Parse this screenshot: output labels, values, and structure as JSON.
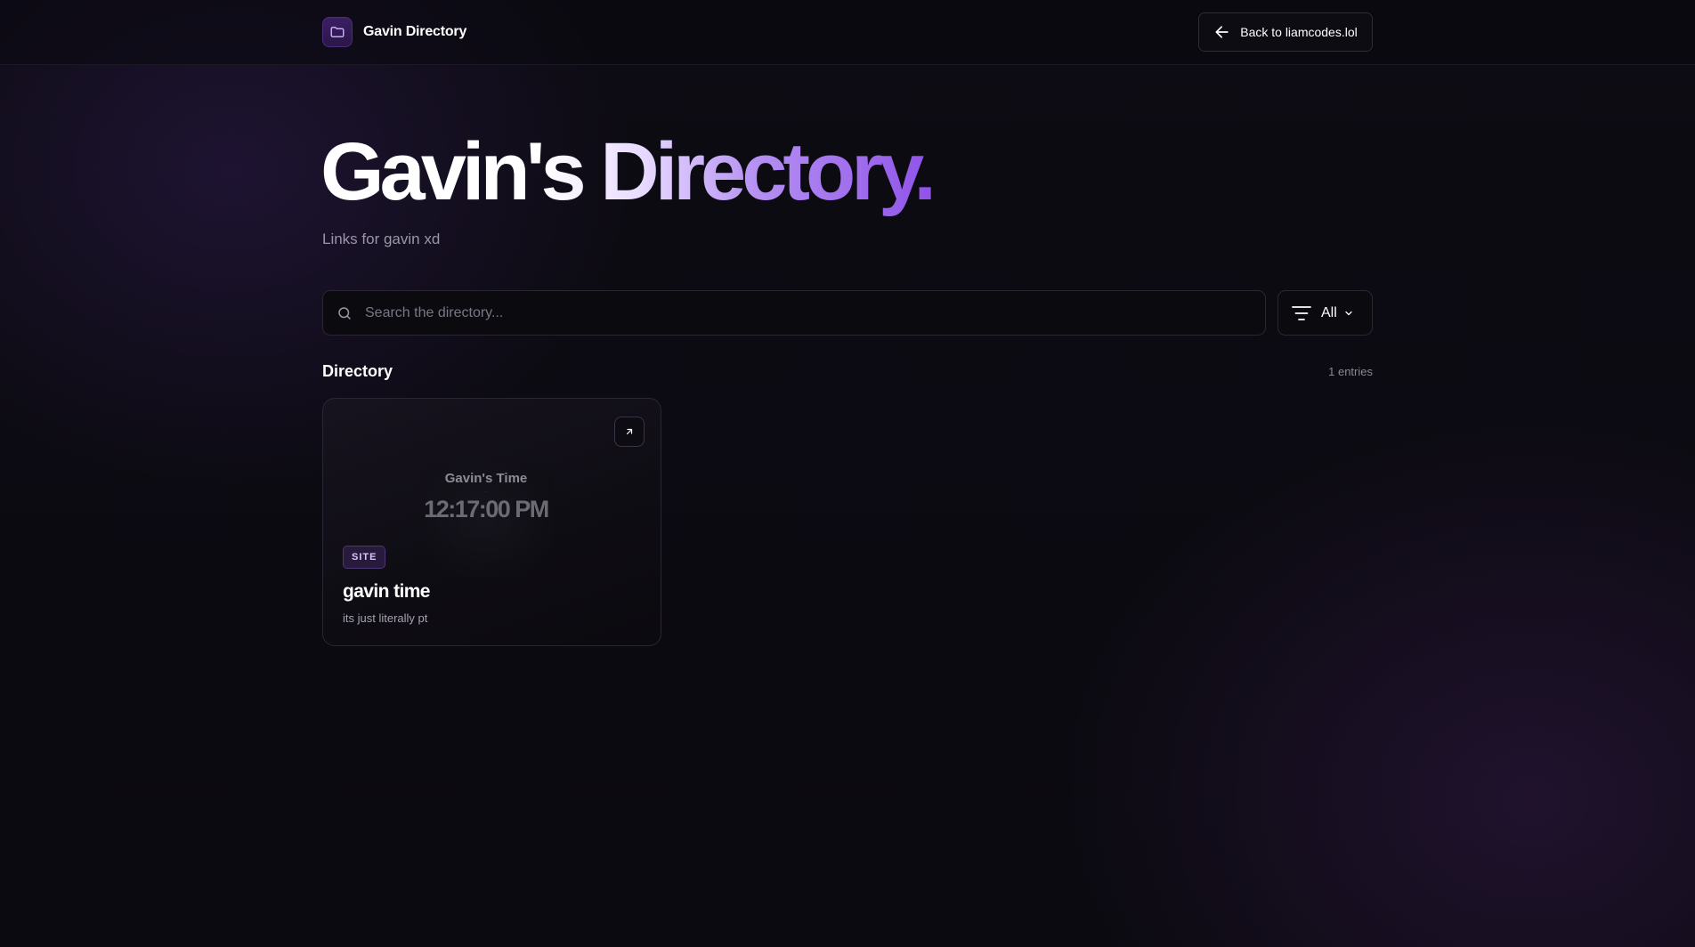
{
  "header": {
    "brand_name": "Gavin Directory",
    "back_label": "Back to liamcodes.lol"
  },
  "hero": {
    "title": "Gavin's Directory.",
    "subtitle": "Links for gavin xd"
  },
  "search": {
    "placeholder": "Search the directory...",
    "value": ""
  },
  "filter": {
    "selected": "All"
  },
  "section": {
    "title": "Directory",
    "count": "1 entries"
  },
  "entries": [
    {
      "badge": "SITE",
      "title": "gavin time",
      "description": "its just literally pt",
      "preview": {
        "heading": "Gavin's Time",
        "time": "12:17:00 PM"
      }
    }
  ],
  "colors": {
    "accent": "#9b5ff0",
    "background": "#0b0a10",
    "badge_bg": "#271a3d"
  },
  "icons": {
    "brand": "folder-icon",
    "back": "arrow-left-icon",
    "search": "search-icon",
    "filter": "filter-lines-icon",
    "dropdown": "chevron-down-icon",
    "external": "arrow-up-right-icon"
  }
}
